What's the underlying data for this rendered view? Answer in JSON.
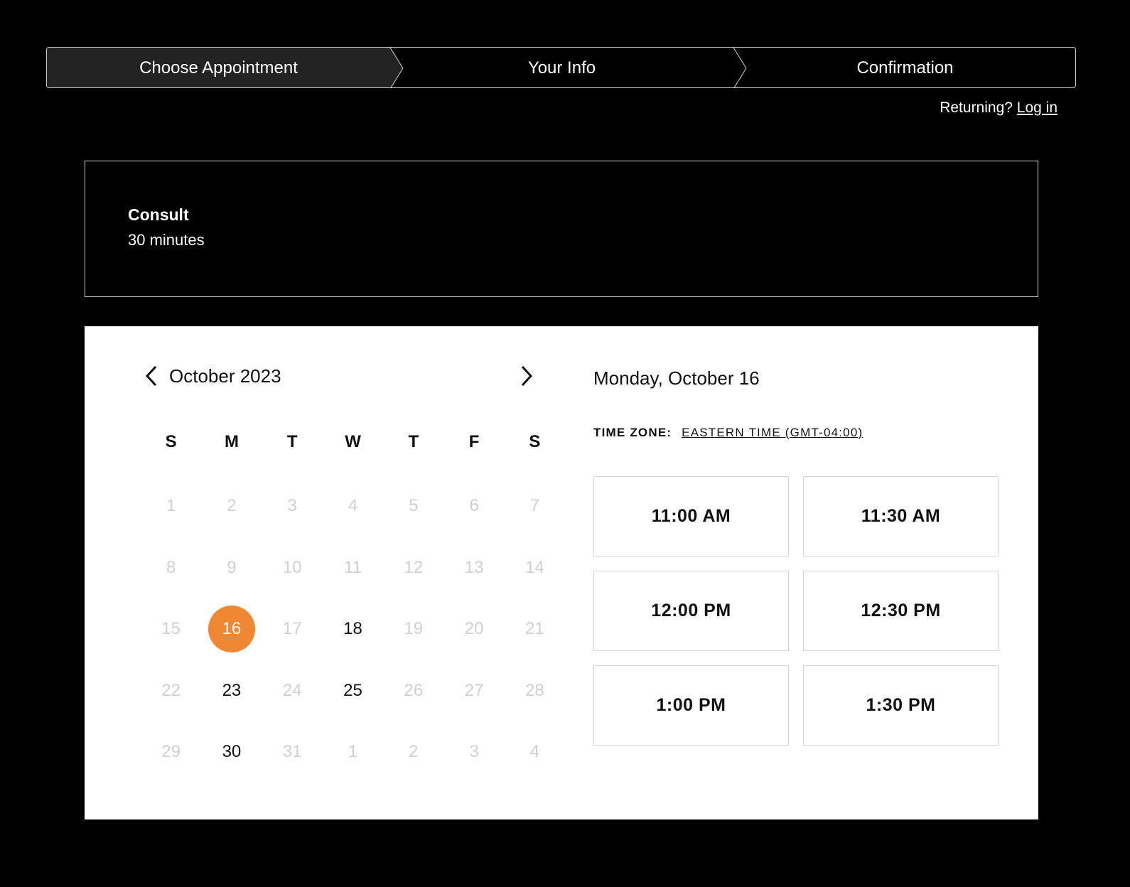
{
  "stepper": {
    "steps": [
      {
        "label": "Choose Appointment",
        "active": true
      },
      {
        "label": "Your Info",
        "active": false
      },
      {
        "label": "Confirmation",
        "active": false
      }
    ],
    "accent_color": "#ef8733"
  },
  "login": {
    "prompt": "Returning?",
    "link_label": "Log in"
  },
  "service": {
    "name": "Consult",
    "duration": "30 minutes"
  },
  "calendar": {
    "month_label": "October 2023",
    "prev_icon": "chevron-left-icon",
    "next_icon": "chevron-right-icon",
    "weekdays": [
      "S",
      "M",
      "T",
      "W",
      "T",
      "F",
      "S"
    ],
    "days": [
      {
        "label": "1",
        "state": "disabled"
      },
      {
        "label": "2",
        "state": "disabled"
      },
      {
        "label": "3",
        "state": "disabled"
      },
      {
        "label": "4",
        "state": "disabled"
      },
      {
        "label": "5",
        "state": "disabled"
      },
      {
        "label": "6",
        "state": "disabled"
      },
      {
        "label": "7",
        "state": "disabled"
      },
      {
        "label": "8",
        "state": "disabled"
      },
      {
        "label": "9",
        "state": "disabled"
      },
      {
        "label": "10",
        "state": "disabled"
      },
      {
        "label": "11",
        "state": "disabled"
      },
      {
        "label": "12",
        "state": "disabled"
      },
      {
        "label": "13",
        "state": "disabled"
      },
      {
        "label": "14",
        "state": "disabled"
      },
      {
        "label": "15",
        "state": "disabled"
      },
      {
        "label": "16",
        "state": "selected"
      },
      {
        "label": "17",
        "state": "disabled"
      },
      {
        "label": "18",
        "state": "available"
      },
      {
        "label": "19",
        "state": "disabled"
      },
      {
        "label": "20",
        "state": "disabled"
      },
      {
        "label": "21",
        "state": "disabled"
      },
      {
        "label": "22",
        "state": "disabled"
      },
      {
        "label": "23",
        "state": "available"
      },
      {
        "label": "24",
        "state": "disabled"
      },
      {
        "label": "25",
        "state": "available"
      },
      {
        "label": "26",
        "state": "disabled"
      },
      {
        "label": "27",
        "state": "disabled"
      },
      {
        "label": "28",
        "state": "disabled"
      },
      {
        "label": "29",
        "state": "disabled"
      },
      {
        "label": "30",
        "state": "available"
      },
      {
        "label": "31",
        "state": "disabled"
      },
      {
        "label": "1",
        "state": "disabled"
      },
      {
        "label": "2",
        "state": "disabled"
      },
      {
        "label": "3",
        "state": "disabled"
      },
      {
        "label": "4",
        "state": "disabled"
      }
    ],
    "selected_color": "#ef8733"
  },
  "times": {
    "date_heading": "Monday, October 16",
    "timezone_label": "TIME ZONE:",
    "timezone_value": "EASTERN TIME (GMT-04:00)",
    "slots": [
      "11:00 AM",
      "11:30 AM",
      "12:00 PM",
      "12:30 PM",
      "1:00 PM",
      "1:30 PM"
    ]
  }
}
